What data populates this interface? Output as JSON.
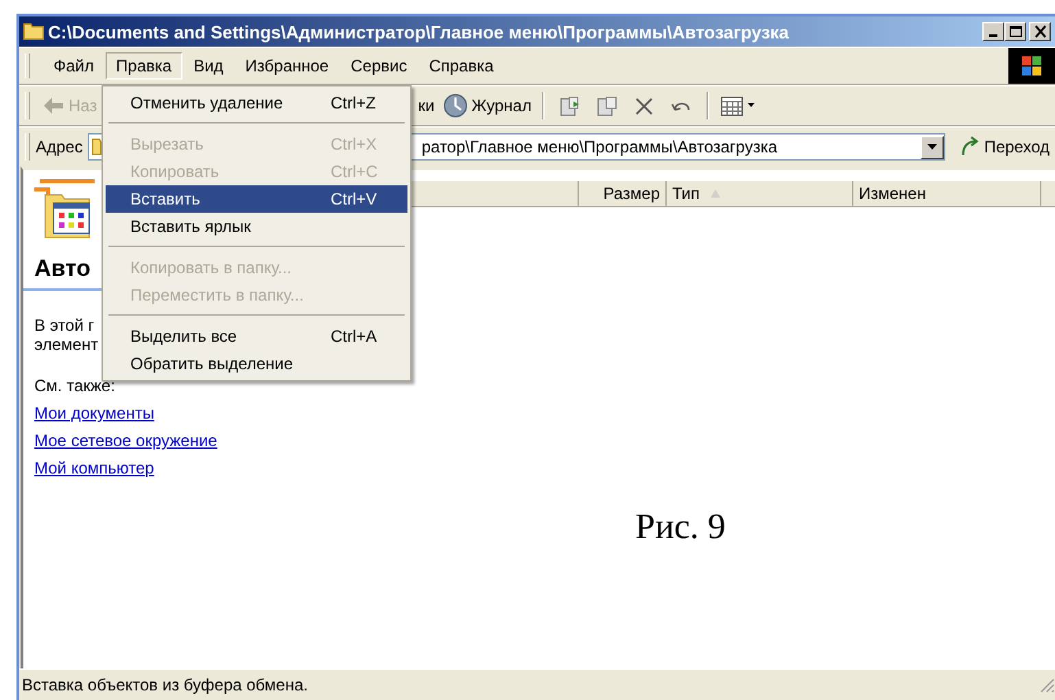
{
  "window": {
    "title": "C:\\Documents and Settings\\Администратор\\Главное меню\\Программы\\Автозагрузка"
  },
  "menu_bar": [
    {
      "label": "Файл",
      "selected": false
    },
    {
      "label": "Правка",
      "selected": true
    },
    {
      "label": "Вид",
      "selected": false
    },
    {
      "label": "Избранное",
      "selected": false
    },
    {
      "label": "Сервис",
      "selected": false
    },
    {
      "label": "Справка",
      "selected": false
    }
  ],
  "toolbar": {
    "back": {
      "label": "Наз",
      "disabled": true
    },
    "folders": {
      "label": "ки"
    },
    "history": {
      "label": "Журнал"
    }
  },
  "address": {
    "label": "Адрес",
    "value": "ратор\\Главное меню\\Программы\\Автозагрузка",
    "go_label": "Переход"
  },
  "columns": [
    {
      "label": "Размер",
      "sorted": false
    },
    {
      "label": "Тип",
      "sorted": true
    },
    {
      "label": "Изменен",
      "sorted": false
    }
  ],
  "task_panel": {
    "heading": "Авто",
    "text_lines": [
      "В этой г",
      "элемент"
    ],
    "see_also": "См. также:",
    "links": [
      "Мои документы",
      "Мое сетевое окружение",
      "Мой компьютер"
    ]
  },
  "caption": "Рис. 9",
  "dropdown": [
    {
      "kind": "item",
      "label": "Отменить удаление",
      "shortcut": "Ctrl+Z",
      "disabled": false,
      "selected": false
    },
    {
      "kind": "separator"
    },
    {
      "kind": "item",
      "label": "Вырезать",
      "shortcut": "Ctrl+X",
      "disabled": true,
      "selected": false
    },
    {
      "kind": "item",
      "label": "Копировать",
      "shortcut": "Ctrl+C",
      "disabled": true,
      "selected": false
    },
    {
      "kind": "item",
      "label": "Вставить",
      "shortcut": "Ctrl+V",
      "disabled": false,
      "selected": true
    },
    {
      "kind": "item",
      "label": "Вставить ярлык",
      "disabled": false,
      "selected": false
    },
    {
      "kind": "separator"
    },
    {
      "kind": "item",
      "label": "Копировать в папку...",
      "disabled": true,
      "selected": false
    },
    {
      "kind": "item",
      "label": "Переместить в папку...",
      "disabled": true,
      "selected": false
    },
    {
      "kind": "separator"
    },
    {
      "kind": "item",
      "label": "Выделить все",
      "shortcut": "Ctrl+A",
      "disabled": false,
      "selected": false
    },
    {
      "kind": "item",
      "label": "Обратить выделение",
      "disabled": false,
      "selected": false
    }
  ],
  "status_bar": "Вставка объектов из буфера обмена."
}
